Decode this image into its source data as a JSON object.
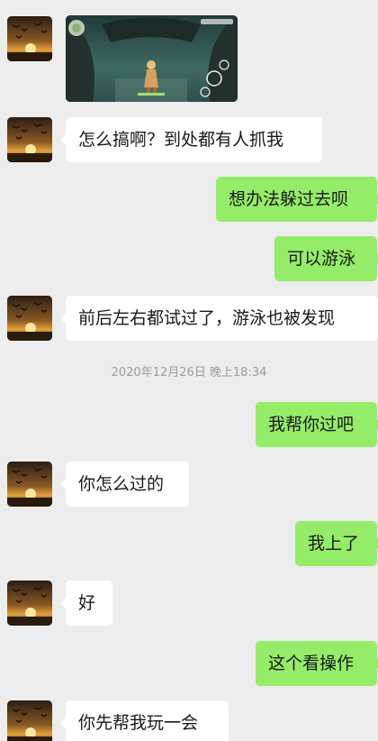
{
  "conversation": {
    "timestamp": "2020年12月26日 晚上18:34",
    "messages": [
      {
        "side": "left",
        "type": "image",
        "image_desc_icon": "game-screenshot-icon"
      },
      {
        "side": "left",
        "type": "text",
        "text": "怎么搞啊？到处都有人抓我"
      },
      {
        "side": "right",
        "type": "text",
        "text": "想办法躲过去呗"
      },
      {
        "side": "right",
        "type": "text",
        "text": "可以游泳"
      },
      {
        "side": "left",
        "type": "text",
        "text": "前后左右都试过了，游泳也被发现"
      },
      {
        "side": "right",
        "type": "text",
        "text": "我帮你过吧"
      },
      {
        "side": "left",
        "type": "text",
        "text": "你怎么过的"
      },
      {
        "side": "right",
        "type": "text",
        "text": "我上了"
      },
      {
        "side": "left",
        "type": "text",
        "text": "好"
      },
      {
        "side": "right",
        "type": "text",
        "text": "这个看操作"
      },
      {
        "side": "left",
        "type": "text",
        "text": "你先帮我玩一会"
      }
    ]
  },
  "colors": {
    "background": "#ededed",
    "left_bubble": "#ffffff",
    "right_bubble": "#95ec69",
    "timestamp_text": "#9b9b9b"
  }
}
